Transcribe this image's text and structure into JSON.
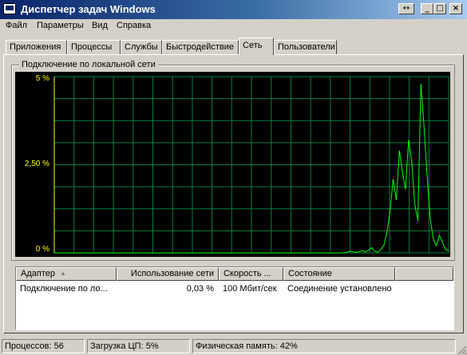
{
  "window": {
    "title": "Диспетчер задач Windows",
    "buttons": {
      "restore_arrows": "↔",
      "minimize": "_",
      "maximize": "□",
      "close": "×"
    }
  },
  "menu": [
    "Файл",
    "Параметры",
    "Вид",
    "Справка"
  ],
  "tabs": [
    {
      "label": "Приложения",
      "active": false
    },
    {
      "label": "Процессы",
      "active": false
    },
    {
      "label": "Службы",
      "active": false
    },
    {
      "label": "Быстродействие",
      "active": false
    },
    {
      "label": "Сеть",
      "active": true
    },
    {
      "label": "Пользователи",
      "active": false
    }
  ],
  "network": {
    "group_title": "Подключение по локальной сети",
    "graph": {
      "y_labels": [
        "5 %",
        "2,50 %",
        "0 %"
      ],
      "y_max_percent": 5,
      "colors": {
        "background": "#000000",
        "grid": "#008040",
        "line": "#00ff00",
        "labels": "#ffff00"
      },
      "samples_percent": [
        0,
        0,
        0,
        0,
        0,
        0,
        0,
        0,
        0,
        0,
        0,
        0,
        0,
        0,
        0,
        0,
        0,
        0,
        0,
        0,
        0,
        0,
        0,
        0,
        0,
        0,
        0,
        0,
        0,
        0,
        0,
        0,
        0,
        0,
        0,
        0,
        0,
        0,
        0,
        0,
        0,
        0,
        0,
        0,
        0,
        0,
        0,
        0,
        0,
        0,
        0,
        0,
        0,
        0,
        0,
        0,
        0,
        0,
        0,
        0,
        0,
        0,
        0,
        0,
        0,
        0,
        0,
        0,
        0,
        0,
        0,
        0,
        0,
        0,
        0,
        0,
        0,
        0,
        0,
        0,
        0,
        0,
        0,
        0,
        0,
        0,
        0,
        0,
        0,
        0,
        0,
        0,
        0,
        0,
        0,
        0.02,
        0.05,
        0.03,
        0.01,
        0.04,
        0.06,
        0.02,
        0.08,
        0.15,
        0.05,
        0.02,
        0.1,
        0.22,
        0.6,
        1.2,
        2.1,
        1.5,
        2.9,
        2.3,
        1.8,
        3.2,
        2.6,
        1.4,
        0.9,
        4.8,
        3.6,
        2.2,
        1.0,
        0.4,
        0.2,
        0.5,
        0.3,
        0.1,
        0.05
      ]
    }
  },
  "adapter_table": {
    "columns": [
      "Адаптер",
      "Использование сети",
      "Скорость ...",
      "Состояние"
    ],
    "rows": [
      [
        "Подключение по ло...",
        "0,03 %",
        "100 Мбит/сек",
        "Соединение установлено"
      ]
    ]
  },
  "statusbar": {
    "processes": "Процессов: 56",
    "cpu": "Загрузка ЦП: 5%",
    "memory": "Физическая память: 42%"
  }
}
